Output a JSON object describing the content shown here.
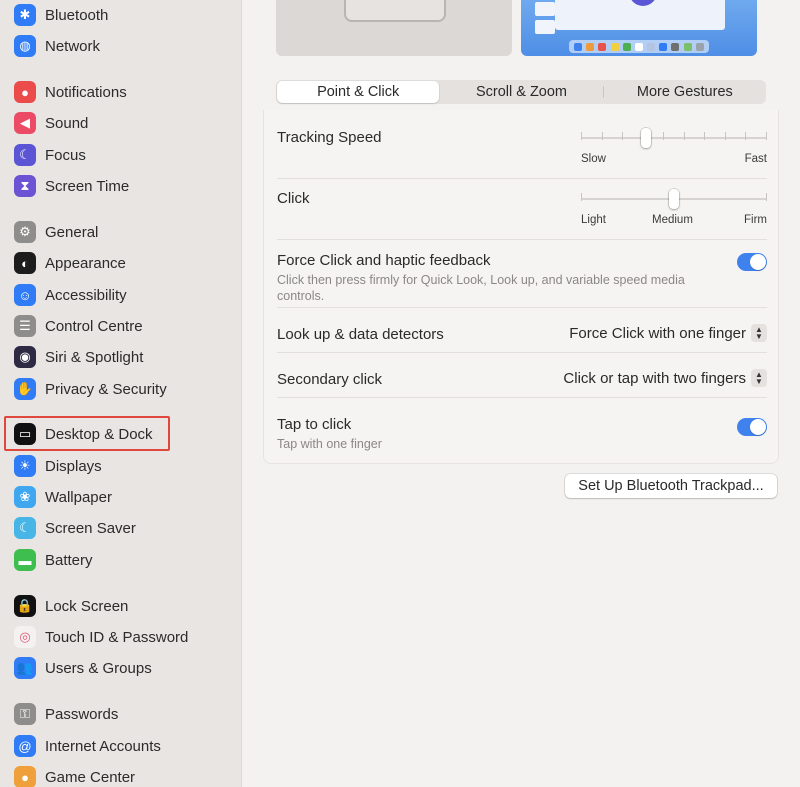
{
  "sidebar": {
    "items": [
      {
        "label": "Bluetooth",
        "icon": "bluetooth-icon",
        "color": "#2f7cf6",
        "glyph": "✱"
      },
      {
        "label": "Network",
        "icon": "network-globe-icon",
        "color": "#2f7cf6",
        "glyph": "◍"
      },
      {
        "label": "Notifications",
        "icon": "notifications-icon",
        "color": "#ec4b4b",
        "glyph": "●"
      },
      {
        "label": "Sound",
        "icon": "sound-icon",
        "color": "#ec4b66",
        "glyph": "◀"
      },
      {
        "label": "Focus",
        "icon": "focus-moon-icon",
        "color": "#5b55d6",
        "glyph": "☾"
      },
      {
        "label": "Screen Time",
        "icon": "hourglass-icon",
        "color": "#6b53d4",
        "glyph": "⧗"
      },
      {
        "label": "General",
        "icon": "gear-icon",
        "color": "#8e8d8c",
        "glyph": "⚙"
      },
      {
        "label": "Appearance",
        "icon": "appearance-icon",
        "color": "#1c1c1c",
        "glyph": "◐"
      },
      {
        "label": "Accessibility",
        "icon": "accessibility-icon",
        "color": "#2f7cf6",
        "glyph": "☺"
      },
      {
        "label": "Control Centre",
        "icon": "control-centre-icon",
        "color": "#8e8d8c",
        "glyph": "☰"
      },
      {
        "label": "Siri & Spotlight",
        "icon": "siri-icon",
        "color": "#2e2a44",
        "glyph": "◉"
      },
      {
        "label": "Privacy & Security",
        "icon": "hand-icon",
        "color": "#2f7cf6",
        "glyph": "✋"
      },
      {
        "label": "Desktop & Dock",
        "icon": "desktop-dock-icon",
        "color": "#111111",
        "glyph": "▭"
      },
      {
        "label": "Displays",
        "icon": "displays-sun-icon",
        "color": "#2f7cf6",
        "glyph": "☀"
      },
      {
        "label": "Wallpaper",
        "icon": "wallpaper-flower-icon",
        "color": "#3fa6f0",
        "glyph": "❀"
      },
      {
        "label": "Screen Saver",
        "icon": "screen-saver-icon",
        "color": "#47b5e6",
        "glyph": "☾"
      },
      {
        "label": "Battery",
        "icon": "battery-icon",
        "color": "#3dbe4f",
        "glyph": "▬"
      },
      {
        "label": "Lock Screen",
        "icon": "lock-icon",
        "color": "#111111",
        "glyph": "🔒"
      },
      {
        "label": "Touch ID & Password",
        "icon": "fingerprint-icon",
        "color": "#f4f1f1",
        "glyph": "◎"
      },
      {
        "label": "Users & Groups",
        "icon": "users-icon",
        "color": "#2f7cf6",
        "glyph": "👥"
      },
      {
        "label": "Passwords",
        "icon": "key-icon",
        "color": "#8e8d8c",
        "glyph": "⚿"
      },
      {
        "label": "Internet Accounts",
        "icon": "at-sign-icon",
        "color": "#2f7cf6",
        "glyph": "@"
      },
      {
        "label": "Game Center",
        "icon": "game-center-icon",
        "color": "#f0a03a",
        "glyph": "●"
      }
    ]
  },
  "tabs": [
    {
      "label": "Point & Click",
      "active": true
    },
    {
      "label": "Scroll & Zoom",
      "active": false
    },
    {
      "label": "More Gestures",
      "active": false
    }
  ],
  "settings": {
    "tracking_speed": {
      "title": "Tracking Speed",
      "min_label": "Slow",
      "max_label": "Fast",
      "value_fraction": 0.34,
      "ticks": 10
    },
    "click": {
      "title": "Click",
      "labels": [
        "Light",
        "Medium",
        "Firm"
      ],
      "value_fraction": 0.5,
      "ticks": 3
    },
    "force_click": {
      "title": "Force Click and haptic feedback",
      "subtitle": "Click then press firmly for Quick Look, Look up, and variable speed media controls.",
      "enabled": true
    },
    "look_up": {
      "title": "Look up & data detectors",
      "value": "Force Click with one finger"
    },
    "secondary_click": {
      "title": "Secondary click",
      "value": "Click or tap with two fingers"
    },
    "tap_to_click": {
      "title": "Tap to click",
      "subtitle": "Tap with one finger",
      "enabled": true
    }
  },
  "buttons": {
    "bluetooth_trackpad": "Set Up Bluetooth Trackpad..."
  },
  "colors": {
    "accent": "#3f82ee",
    "highlight_box": "#e0483d"
  }
}
